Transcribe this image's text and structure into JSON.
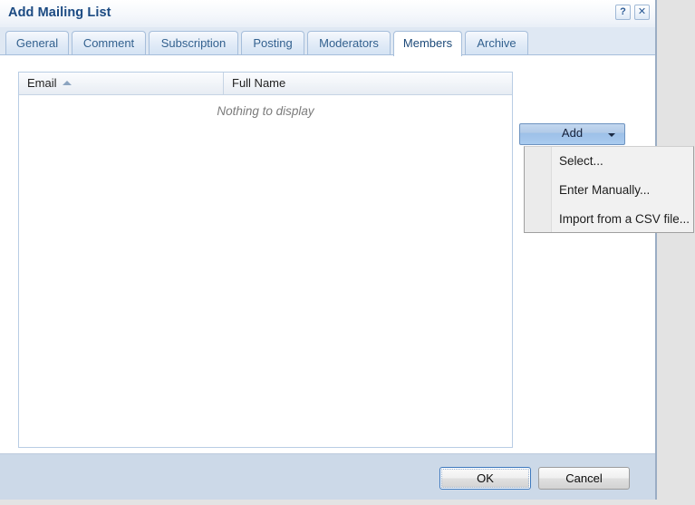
{
  "window": {
    "title": "Add Mailing List",
    "help_button": "?",
    "close_button": "✕"
  },
  "tabs": [
    {
      "label": "General",
      "active": false
    },
    {
      "label": "Comment",
      "active": false
    },
    {
      "label": "Subscription",
      "active": false
    },
    {
      "label": "Posting",
      "active": false
    },
    {
      "label": "Moderators",
      "active": false
    },
    {
      "label": "Members",
      "active": true
    },
    {
      "label": "Archive",
      "active": false
    }
  ],
  "members_grid": {
    "columns": [
      {
        "label": "Email",
        "sort": "ascending"
      },
      {
        "label": "Full Name",
        "sort": "none"
      }
    ],
    "rows": [],
    "empty_text": "Nothing to display"
  },
  "add_control": {
    "label": "Add",
    "menu_open": true,
    "menu_items": [
      {
        "label": "Select..."
      },
      {
        "label": "Enter Manually..."
      },
      {
        "label": "Import from a CSV file..."
      }
    ]
  },
  "footer": {
    "ok_label": "OK",
    "cancel_label": "Cancel"
  },
  "colors": {
    "title_text": "#1b4a82",
    "tabstrip_bg": "#dfe8f3",
    "footer_bg": "#ccd9e8",
    "desktop_bg": "#e3e3e3",
    "grid_border": "#b9cde4",
    "add_button_border": "#6d93c0",
    "empty_text": "#7b7b7b",
    "ok_focus_border": "#3d78bd"
  }
}
